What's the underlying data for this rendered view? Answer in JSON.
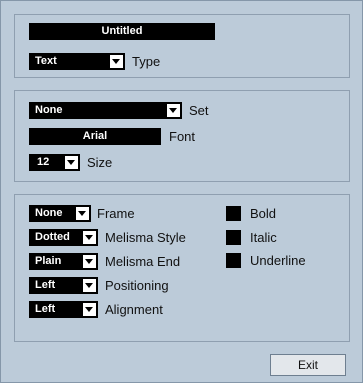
{
  "title_panel": {
    "title_value": "Untitled",
    "type_value": "Text",
    "type_label": "Type"
  },
  "font_panel": {
    "set_value": "None",
    "set_label": "Set",
    "font_value": "Arial",
    "font_label": "Font",
    "size_value": "12",
    "size_label": "Size"
  },
  "style_panel": {
    "frame_value": "None",
    "frame_label": "Frame",
    "melisma_style_value": "Dotted",
    "melisma_style_label": "Melisma Style",
    "melisma_end_value": "Plain",
    "melisma_end_label": "Melisma End",
    "positioning_value": "Left",
    "positioning_label": "Positioning",
    "alignment_value": "Left",
    "alignment_label": "Alignment",
    "bold_label": "Bold",
    "italic_label": "Italic",
    "underline_label": "Underline"
  },
  "footer": {
    "exit_label": "Exit"
  },
  "colors": {
    "window_bg": "#bccbd9",
    "field_bg": "#000000",
    "field_text": "#ffffff",
    "button_bg": "#e3e7eb"
  }
}
